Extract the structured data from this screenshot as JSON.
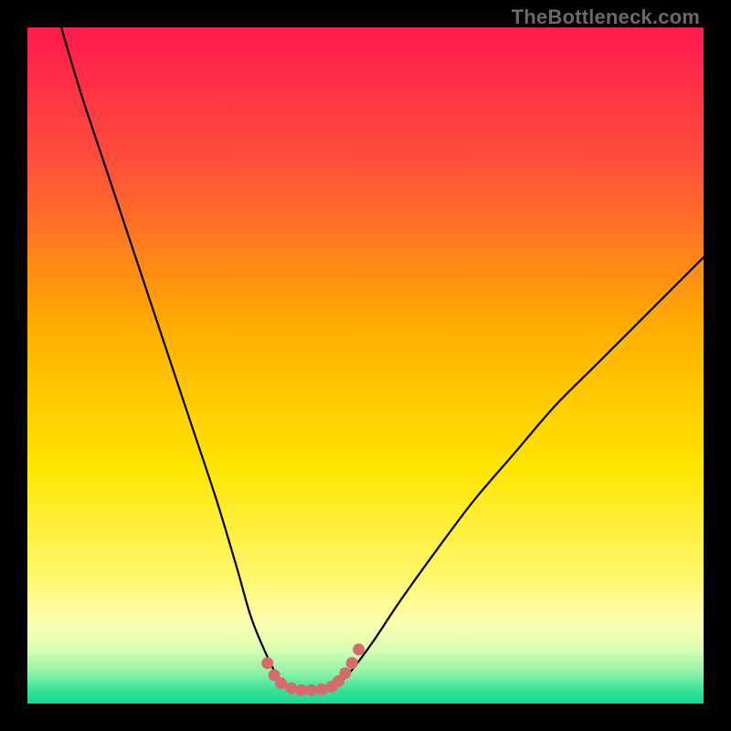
{
  "watermark": {
    "text": "TheBottleneck.com"
  },
  "colors": {
    "black": "#000000",
    "curve": "#000000",
    "marker": "#d96a6a",
    "gradient_stops": [
      {
        "offset": 0.0,
        "color": "#ff1a4d"
      },
      {
        "offset": 0.2,
        "color": "#ff4f3a"
      },
      {
        "offset": 0.45,
        "color": "#ffb000"
      },
      {
        "offset": 0.65,
        "color": "#ffe500"
      },
      {
        "offset": 0.82,
        "color": "#fff873"
      },
      {
        "offset": 0.88,
        "color": "#ffffb0"
      },
      {
        "offset": 0.92,
        "color": "#d9ffb3"
      },
      {
        "offset": 0.955,
        "color": "#8cf2a8"
      },
      {
        "offset": 0.98,
        "color": "#38e29a"
      },
      {
        "offset": 1.0,
        "color": "#14d88f"
      }
    ]
  },
  "chart_data": {
    "type": "line",
    "title": "",
    "xlabel": "",
    "ylabel": "",
    "xlim": [
      0,
      100
    ],
    "ylim": [
      0,
      100
    ],
    "series": [
      {
        "name": "bottleneck-curve",
        "x": [
          5,
          8,
          12,
          16,
          20,
          24,
          28,
          31,
          33,
          35,
          37,
          38.5,
          40,
          42,
          44,
          46,
          48,
          51,
          55,
          60,
          66,
          72,
          78,
          84,
          90,
          96,
          100
        ],
        "values": [
          100,
          90,
          78,
          66,
          54,
          42,
          30,
          20,
          13,
          8,
          4,
          2.5,
          2,
          2,
          2.2,
          3,
          5,
          9,
          15,
          22,
          30,
          37,
          44,
          50,
          56,
          62,
          66
        ]
      }
    ],
    "markers": {
      "name": "trough-beads",
      "x": [
        35.5,
        36.5,
        37.5,
        39,
        40.5,
        42,
        43.5,
        45,
        46,
        47,
        48,
        49
      ],
      "values": [
        6.0,
        4.2,
        3.0,
        2.3,
        2.0,
        2.0,
        2.1,
        2.5,
        3.3,
        4.5,
        6.0,
        8.0
      ]
    }
  }
}
